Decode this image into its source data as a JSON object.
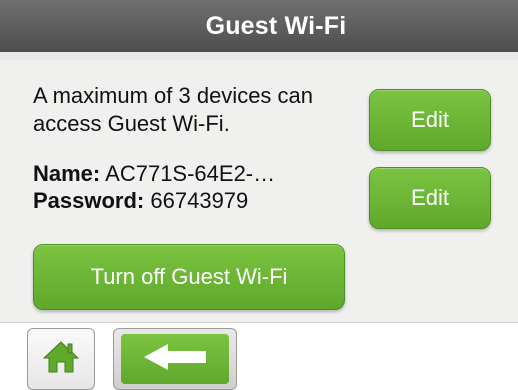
{
  "header": {
    "title": "Guest Wi-Fi"
  },
  "info": {
    "description": "A maximum of 3 devices can access Guest Wi-Fi."
  },
  "credentials": {
    "name_label": "Name:",
    "name_value": "AC771S-64E2-…",
    "password_label": "Password:",
    "password_value": "66743979"
  },
  "buttons": {
    "edit_name": "Edit",
    "edit_password": "Edit",
    "turn_off": "Turn off Guest Wi-Fi"
  },
  "footer": {
    "home_icon": "home-icon",
    "back_icon": "back-arrow-icon"
  },
  "colors": {
    "accent_green": "#6cb637",
    "header_gray": "#5e5e5e"
  }
}
